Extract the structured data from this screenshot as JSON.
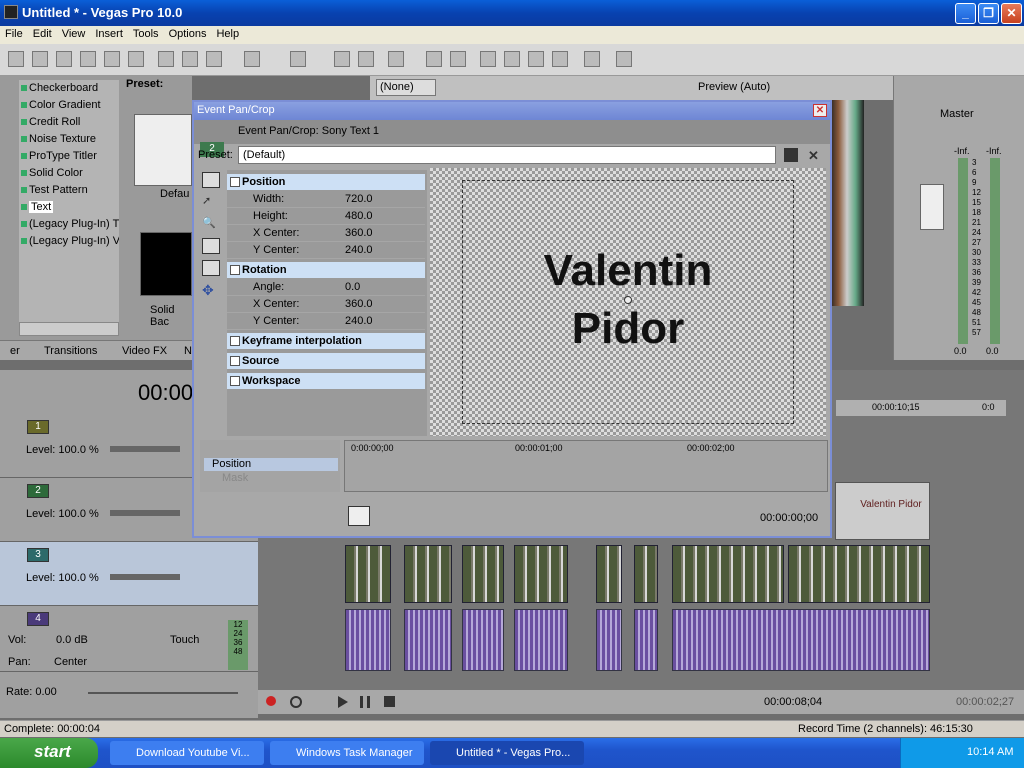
{
  "window": {
    "title": "Untitled * - Vegas Pro 10.0"
  },
  "menu": [
    "File",
    "Edit",
    "View",
    "Insert",
    "Tools",
    "Options",
    "Help"
  ],
  "generators": {
    "items": [
      "Checkerboard",
      "Color Gradient",
      "Credit Roll",
      "Noise Texture",
      "ProType Titler",
      "Solid Color",
      "Test Pattern",
      "Text",
      "(Legacy Plug-In) T",
      "(Legacy Plug-In) V"
    ],
    "selected": "Text",
    "preset_label": "Preset:",
    "thumb1": "Defau",
    "thumb2": "Solid Bac",
    "tabs": [
      "er",
      "Transitions",
      "Video FX",
      "N"
    ]
  },
  "preview": {
    "none": "(None)",
    "quality": "Preview (Auto)"
  },
  "master": {
    "label": "Master",
    "left_db": "-Inf.",
    "right_db": "-Inf.",
    "scale": [
      "3",
      "6",
      "9",
      "12",
      "15",
      "18",
      "21",
      "24",
      "27",
      "30",
      "33",
      "36",
      "39",
      "42",
      "45",
      "48",
      "51",
      "57"
    ],
    "bottom_left": "0.0",
    "bottom_right": "0.0"
  },
  "dialog": {
    "title": "Event Pan/Crop",
    "track_num": "2",
    "subtitle": "Event Pan/Crop: Sony Text 1",
    "preset_label": "Preset:",
    "preset_value": "(Default)",
    "position": {
      "header": "Position",
      "rows": [
        [
          "Width:",
          "720.0"
        ],
        [
          "Height:",
          "480.0"
        ],
        [
          "X Center:",
          "360.0"
        ],
        [
          "Y Center:",
          "240.0"
        ]
      ]
    },
    "rotation": {
      "header": "Rotation",
      "rows": [
        [
          "Angle:",
          "0.0"
        ],
        [
          "X Center:",
          "360.0"
        ],
        [
          "Y Center:",
          "240.0"
        ]
      ]
    },
    "sections": [
      "Keyframe interpolation",
      "Source",
      "Workspace"
    ],
    "preview_line1": "Valentin",
    "preview_line2": "Pidor",
    "timeline": {
      "ticks": [
        "0:00:00;00",
        "00:00:01;00",
        "00:00:02;00"
      ],
      "row1": "Position",
      "row2": "Mask",
      "time": "00:00:00;00"
    }
  },
  "timeline": {
    "timecode": "00:00",
    "ruler_time": "00:00:10;15",
    "ruler_end": "0:0",
    "tracks": [
      {
        "num": "1",
        "level": "Level: 100.0 %"
      },
      {
        "num": "2",
        "level": "Level: 100.0 %"
      },
      {
        "num": "3",
        "level": "Level: 100.0 %"
      }
    ],
    "audio": {
      "num": "4",
      "vol": "Vol:",
      "vol_value": "0.0 dB",
      "pan": "Pan:",
      "pan_value": "Center",
      "touch": "Touch",
      "meter": [
        "12",
        "24",
        "36",
        "48"
      ]
    },
    "rate": "Rate: 0.00",
    "clip_label": "Valentin Pidor",
    "position_time": "00:00:08;04",
    "end_time": "00:00:02;27"
  },
  "status": {
    "left": "Complete: 00:00:04",
    "right": "Record Time (2 channels): 46:15:30"
  },
  "taskbar": {
    "start": "start",
    "tasks": [
      "Download Youtube Vi...",
      "Windows Task Manager",
      "Untitled * - Vegas Pro..."
    ],
    "clock": "10:14 AM"
  }
}
